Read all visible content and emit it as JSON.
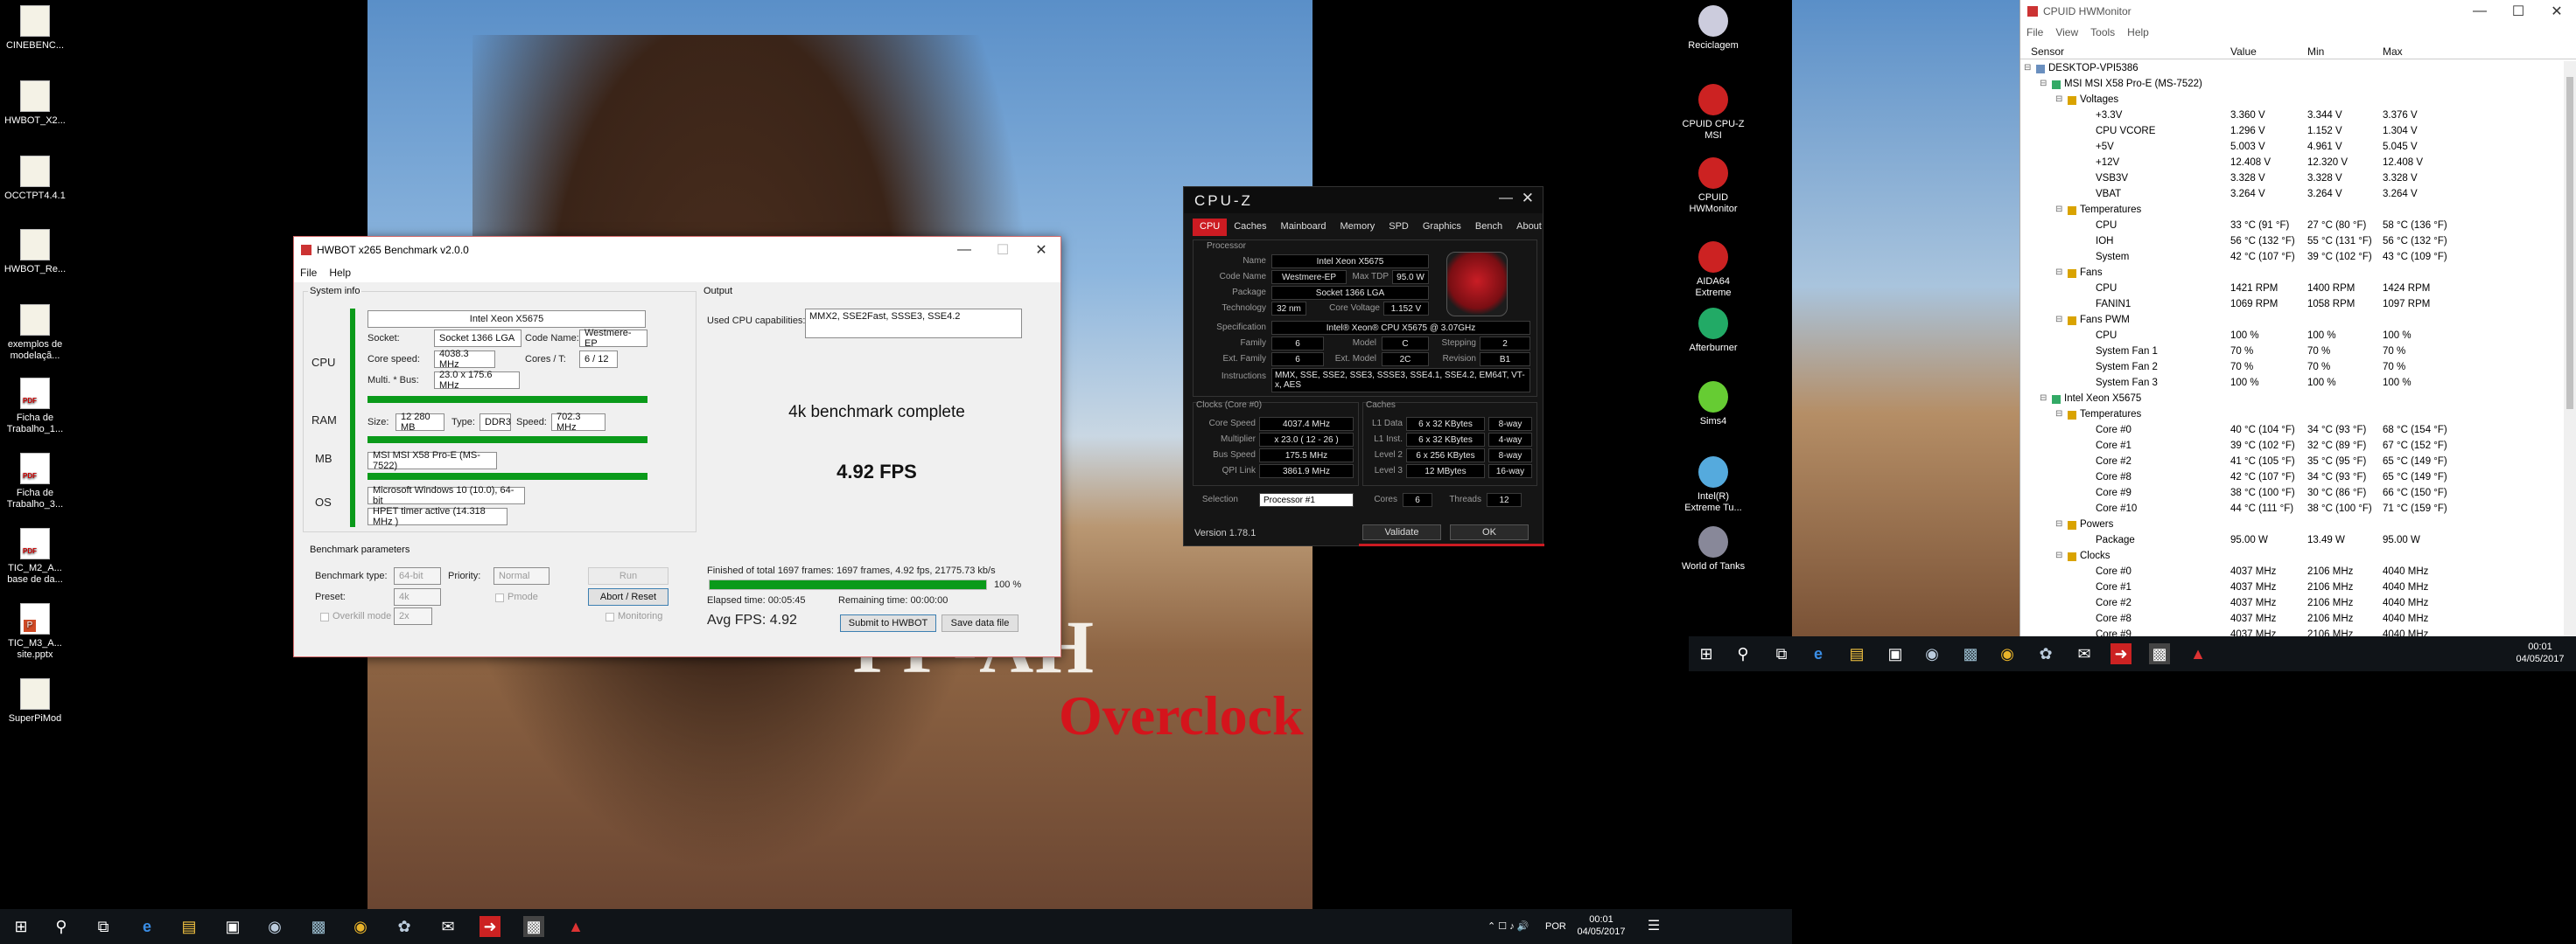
{
  "desktop": {
    "icons": [
      {
        "label": "CINEBENC...",
        "type": "file"
      },
      {
        "label": "HWBOT_X2...",
        "type": "file"
      },
      {
        "label": "OCCTPT4.4.1",
        "type": "file"
      },
      {
        "label": "HWBOT_Re...",
        "type": "file"
      },
      {
        "label": "exemplos de modelaçã...",
        "type": "doc"
      },
      {
        "label": "Ficha de Trabalho_1...",
        "type": "pdf"
      },
      {
        "label": "Ficha de Trabalho_3...",
        "type": "pdf"
      },
      {
        "label": "TIC_M2_A... base de da...",
        "type": "pdf"
      },
      {
        "label": "TIC_M3_A... site.pptx",
        "type": "ppt"
      },
      {
        "label": "SuperPiMod",
        "type": "file"
      }
    ],
    "right_icons": [
      {
        "label": "Reciclagem",
        "icon": "recycle-bin-icon"
      },
      {
        "label": "CPUID CPU-Z MSI",
        "icon": "cpuz-icon"
      },
      {
        "label": "CPUID HWMonitor",
        "icon": "hwmonitor-icon"
      },
      {
        "label": "AIDA64 Extreme",
        "icon": "aida64-icon"
      },
      {
        "label": "Afterburner",
        "icon": "afterburner-icon"
      },
      {
        "label": "Sims4",
        "icon": "sims4-icon"
      },
      {
        "label": "Intel(R) Extreme Tu...",
        "icon": "intel-xtu-icon"
      },
      {
        "label": "World of Tanks",
        "icon": "wot-icon"
      }
    ],
    "wallpaper_text": {
      "top": "ГГ-АН",
      "bottom": "Overclock"
    }
  },
  "hwbot": {
    "title": "HWBOT x265 Benchmark v2.0.0",
    "menu": [
      "File",
      "Help"
    ],
    "system_info": "System info",
    "output": "Output",
    "cpu_label": "CPU",
    "ram_label": "RAM",
    "mb_label": "MB",
    "os_label": "OS",
    "cpu_name": "Intel Xeon X5675",
    "socket_lbl": "Socket:",
    "socket": "Socket 1366 LGA",
    "codename_lbl": "Code Name:",
    "codename": "Westmere-EP",
    "corespeed_lbl": "Core speed:",
    "corespeed": "4038.3 MHz",
    "cores_lbl": "Cores / T:",
    "cores": "6 / 12",
    "mult_lbl": "Multi. * Bus:",
    "mult": "23.0 x 175.6 MHz",
    "size_lbl": "Size:",
    "size": "12 280 MB",
    "type_lbl": "Type:",
    "type": "DDR3",
    "speed_lbl": "Speed:",
    "speed": "702.3 MHz",
    "mb": "MSI MSI X58 Pro-E (MS-7522)",
    "os": "Microsoft Windows 10 (10.0), 64-bit",
    "timer": "HPET timer active (14.318 MHz )",
    "caps_lbl": "Used CPU capabilities:",
    "caps": "MMX2, SSE2Fast, SSSE3, SSE4.2",
    "status": "4k benchmark complete",
    "fps": "4.92 FPS",
    "finished": "Finished of total 1697 frames: 1697 frames, 4.92 fps,  21775.73 kb/s",
    "progress": 1.0,
    "progress_text": "100 %",
    "elapsed": "Elapsed time: 00:05:45",
    "remaining": "Remaining time: 00:00:00",
    "avg": "Avg FPS: 4.92",
    "params": "Benchmark parameters",
    "btype_lbl": "Benchmark type:",
    "btype": "64-bit",
    "priority_lbl": "Priority:",
    "priority": "Normal",
    "run": "Run",
    "preset_lbl": "Preset:",
    "preset": "4k",
    "pmode": "Pmode",
    "abort": "Abort / Reset",
    "overkill": "Overkill mode",
    "overkill_val": "2x",
    "monitoring": "Monitoring",
    "submit": "Submit to HWBOT",
    "save": "Save data file"
  },
  "cpuz": {
    "title": "CPU-Z",
    "tabs": [
      "CPU",
      "Caches",
      "Mainboard",
      "Memory",
      "SPD",
      "Graphics",
      "Bench",
      "About"
    ],
    "processor": "Processor",
    "name_lbl": "Name",
    "name": "Intel Xeon X5675",
    "codename_lbl": "Code Name",
    "codename": "Westmere-EP",
    "tdp_lbl": "Max TDP",
    "tdp": "95.0 W",
    "package_lbl": "Package",
    "package": "Socket 1366 LGA",
    "tech_lbl": "Technology",
    "tech": "32 nm",
    "cv_lbl": "Core Voltage",
    "cv": "1.152 V",
    "spec_lbl": "Specification",
    "spec": "Intel® Xeon® CPU        X5675  @ 3.07GHz",
    "family_lbl": "Family",
    "family": "6",
    "model_lbl": "Model",
    "model": "C",
    "stepping_lbl": "Stepping",
    "stepping": "2",
    "extfam_lbl": "Ext. Family",
    "extfam": "6",
    "extmod_lbl": "Ext. Model",
    "extmod": "2C",
    "rev_lbl": "Revision",
    "rev": "B1",
    "instr_lbl": "Instructions",
    "instr": "MMX, SSE, SSE2, SSE3, SSSE3, SSE4.1, SSE4.2, EM64T, VT-x, AES",
    "clocks": "Clocks (Core #0)",
    "caches": "Caches",
    "cs_lbl": "Core Speed",
    "cs": "4037.4 MHz",
    "mult_lbl": "Multiplier",
    "mult": "x 23.0 ( 12 - 26 )",
    "bus_lbl": "Bus Speed",
    "bus": "175.5 MHz",
    "qpi_lbl": "QPI Link",
    "qpi": "3861.9 MHz",
    "l1d_lbl": "L1 Data",
    "l1d": "6 x 32 KBytes",
    "l1d_w": "8-way",
    "l1i_lbl": "L1 Inst.",
    "l1i": "6 x 32 KBytes",
    "l1i_w": "4-way",
    "l2_lbl": "Level 2",
    "l2": "6 x 256 KBytes",
    "l2_w": "8-way",
    "l3_lbl": "Level 3",
    "l3": "12 MBytes",
    "l3_w": "16-way",
    "sel_lbl": "Selection",
    "sel": "Processor #1",
    "cores_lbl": "Cores",
    "cores": "6",
    "threads_lbl": "Threads",
    "threads": "12",
    "version": "Version 1.78.1",
    "validate": "Validate",
    "ok": "OK"
  },
  "hwmon": {
    "title": "CPUID HWMonitor",
    "menu": [
      "File",
      "View",
      "Tools",
      "Help"
    ],
    "cols": [
      "Sensor",
      "Value",
      "Min",
      "Max"
    ],
    "rows": [
      {
        "i": 0,
        "n": "DESKTOP-VPI5386",
        "v": "",
        "mi": "",
        "ma": ""
      },
      {
        "i": 1,
        "n": "MSI MSI X58 Pro-E (MS-7522)",
        "v": "",
        "mi": "",
        "ma": ""
      },
      {
        "i": 2,
        "n": "Voltages",
        "v": "",
        "mi": "",
        "ma": ""
      },
      {
        "i": 3,
        "n": "+3.3V",
        "v": "3.360 V",
        "mi": "3.344 V",
        "ma": "3.376 V"
      },
      {
        "i": 3,
        "n": "CPU VCORE",
        "v": "1.296 V",
        "mi": "1.152 V",
        "ma": "1.304 V"
      },
      {
        "i": 3,
        "n": "+5V",
        "v": "5.003 V",
        "mi": "4.961 V",
        "ma": "5.045 V"
      },
      {
        "i": 3,
        "n": "+12V",
        "v": "12.408 V",
        "mi": "12.320 V",
        "ma": "12.408 V"
      },
      {
        "i": 3,
        "n": "VSB3V",
        "v": "3.328 V",
        "mi": "3.328 V",
        "ma": "3.328 V"
      },
      {
        "i": 3,
        "n": "VBAT",
        "v": "3.264 V",
        "mi": "3.264 V",
        "ma": "3.264 V"
      },
      {
        "i": 2,
        "n": "Temperatures",
        "v": "",
        "mi": "",
        "ma": ""
      },
      {
        "i": 3,
        "n": "CPU",
        "v": "33 °C  (91 °F)",
        "mi": "27 °C  (80 °F)",
        "ma": "58 °C  (136 °F)"
      },
      {
        "i": 3,
        "n": "IOH",
        "v": "56 °C  (132 °F)",
        "mi": "55 °C  (131 °F)",
        "ma": "56 °C  (132 °F)"
      },
      {
        "i": 3,
        "n": "System",
        "v": "42 °C  (107 °F)",
        "mi": "39 °C  (102 °F)",
        "ma": "43 °C  (109 °F)"
      },
      {
        "i": 2,
        "n": "Fans",
        "v": "",
        "mi": "",
        "ma": ""
      },
      {
        "i": 3,
        "n": "CPU",
        "v": "1421 RPM",
        "mi": "1400 RPM",
        "ma": "1424 RPM"
      },
      {
        "i": 3,
        "n": "FANIN1",
        "v": "1069 RPM",
        "mi": "1058 RPM",
        "ma": "1097 RPM"
      },
      {
        "i": 2,
        "n": "Fans PWM",
        "v": "",
        "mi": "",
        "ma": ""
      },
      {
        "i": 3,
        "n": "CPU",
        "v": "100 %",
        "mi": "100 %",
        "ma": "100 %"
      },
      {
        "i": 3,
        "n": "System Fan 1",
        "v": "70 %",
        "mi": "70 %",
        "ma": "70 %"
      },
      {
        "i": 3,
        "n": "System Fan 2",
        "v": "70 %",
        "mi": "70 %",
        "ma": "70 %"
      },
      {
        "i": 3,
        "n": "System Fan 3",
        "v": "100 %",
        "mi": "100 %",
        "ma": "100 %"
      },
      {
        "i": 1,
        "n": "Intel Xeon X5675",
        "v": "",
        "mi": "",
        "ma": ""
      },
      {
        "i": 2,
        "n": "Temperatures",
        "v": "",
        "mi": "",
        "ma": ""
      },
      {
        "i": 3,
        "n": "Core #0",
        "v": "40 °C  (104 °F)",
        "mi": "34 °C  (93 °F)",
        "ma": "68 °C  (154 °F)"
      },
      {
        "i": 3,
        "n": "Core #1",
        "v": "39 °C  (102 °F)",
        "mi": "32 °C  (89 °F)",
        "ma": "67 °C  (152 °F)"
      },
      {
        "i": 3,
        "n": "Core #2",
        "v": "41 °C  (105 °F)",
        "mi": "35 °C  (95 °F)",
        "ma": "65 °C  (149 °F)"
      },
      {
        "i": 3,
        "n": "Core #8",
        "v": "42 °C  (107 °F)",
        "mi": "34 °C  (93 °F)",
        "ma": "65 °C  (149 °F)"
      },
      {
        "i": 3,
        "n": "Core #9",
        "v": "38 °C  (100 °F)",
        "mi": "30 °C  (86 °F)",
        "ma": "66 °C  (150 °F)"
      },
      {
        "i": 3,
        "n": "Core #10",
        "v": "44 °C  (111 °F)",
        "mi": "38 °C  (100 °F)",
        "ma": "71 °C  (159 °F)"
      },
      {
        "i": 2,
        "n": "Powers",
        "v": "",
        "mi": "",
        "ma": ""
      },
      {
        "i": 3,
        "n": "Package",
        "v": "95.00 W",
        "mi": "13.49 W",
        "ma": "95.00 W"
      },
      {
        "i": 2,
        "n": "Clocks",
        "v": "",
        "mi": "",
        "ma": ""
      },
      {
        "i": 3,
        "n": "Core #0",
        "v": "4037 MHz",
        "mi": "2106 MHz",
        "ma": "4040 MHz"
      },
      {
        "i": 3,
        "n": "Core #1",
        "v": "4037 MHz",
        "mi": "2106 MHz",
        "ma": "4040 MHz"
      },
      {
        "i": 3,
        "n": "Core #2",
        "v": "4037 MHz",
        "mi": "2106 MHz",
        "ma": "4040 MHz"
      },
      {
        "i": 3,
        "n": "Core #8",
        "v": "4037 MHz",
        "mi": "2106 MHz",
        "ma": "4040 MHz"
      },
      {
        "i": 3,
        "n": "Core #9",
        "v": "4037 MHz",
        "mi": "2106 MHz",
        "ma": "4040 MHz"
      }
    ]
  },
  "taskbar": {
    "time": "00:01",
    "date": "04/05/2017",
    "lang": "POR"
  },
  "taskbar2": {
    "time": "00:01",
    "date": "04/05/2017"
  },
  "colors": {
    "accent_red": "#cc1b22",
    "green": "#0a9a1a",
    "taskbar": "#101418"
  }
}
